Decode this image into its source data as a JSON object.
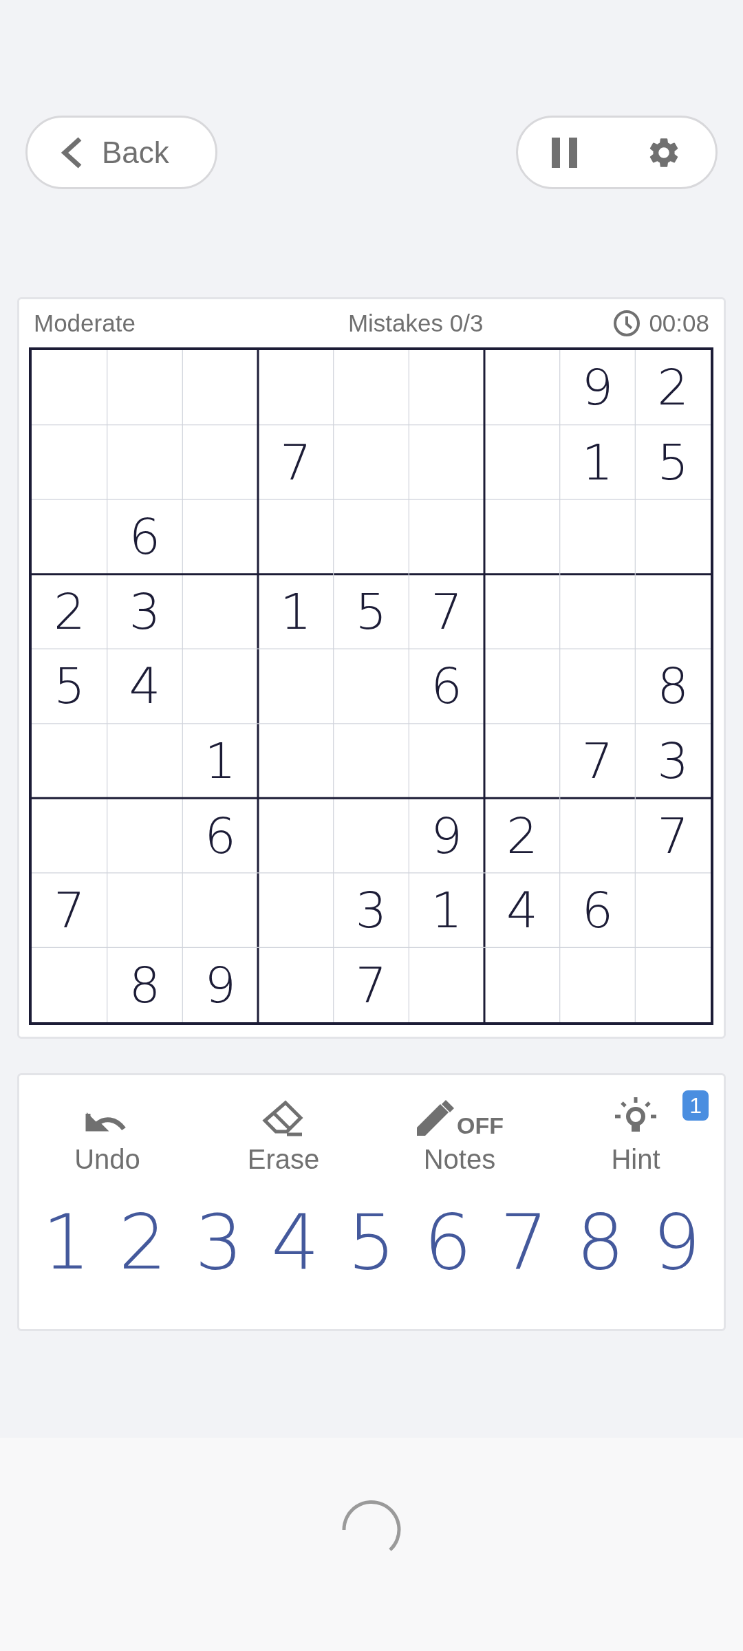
{
  "top_bar": {
    "back": {
      "label": "Back"
    }
  },
  "status": {
    "difficulty": "Moderate",
    "mistakes": "Mistakes 0/3",
    "timer": "00:08"
  },
  "grid": [
    [
      {
        "kind": "blank"
      },
      {
        "kind": "blank"
      },
      {
        "kind": "blank"
      },
      {
        "kind": "blank"
      },
      {
        "kind": "blank"
      },
      {
        "kind": "blank"
      },
      {
        "kind": "blank"
      },
      {
        "kind": "given",
        "digit": "9"
      },
      {
        "kind": "given",
        "digit": "2"
      }
    ],
    [
      {
        "kind": "blank"
      },
      {
        "kind": "blank"
      },
      {
        "kind": "blank"
      },
      {
        "kind": "given",
        "digit": "7"
      },
      {
        "kind": "blank"
      },
      {
        "kind": "blank"
      },
      {
        "kind": "blank"
      },
      {
        "kind": "given",
        "digit": "1"
      },
      {
        "kind": "given",
        "digit": "5"
      }
    ],
    [
      {
        "kind": "blank"
      },
      {
        "kind": "given",
        "digit": "6"
      },
      {
        "kind": "blank"
      },
      {
        "kind": "blank"
      },
      {
        "kind": "blank"
      },
      {
        "kind": "blank"
      },
      {
        "kind": "blank"
      },
      {
        "kind": "blank"
      },
      {
        "kind": "blank"
      }
    ],
    [
      {
        "kind": "given",
        "digit": "2"
      },
      {
        "kind": "given",
        "digit": "3"
      },
      {
        "kind": "blank"
      },
      {
        "kind": "given",
        "digit": "1"
      },
      {
        "kind": "given",
        "digit": "5"
      },
      {
        "kind": "given",
        "digit": "7"
      },
      {
        "kind": "blank"
      },
      {
        "kind": "blank"
      },
      {
        "kind": "blank"
      }
    ],
    [
      {
        "kind": "given",
        "digit": "5"
      },
      {
        "kind": "given",
        "digit": "4"
      },
      {
        "kind": "blank"
      },
      {
        "kind": "blank"
      },
      {
        "kind": "blank"
      },
      {
        "kind": "given",
        "digit": "6"
      },
      {
        "kind": "blank"
      },
      {
        "kind": "blank"
      },
      {
        "kind": "given",
        "digit": "8"
      }
    ],
    [
      {
        "kind": "blank"
      },
      {
        "kind": "blank"
      },
      {
        "kind": "given",
        "digit": "1"
      },
      {
        "kind": "blank"
      },
      {
        "kind": "blank"
      },
      {
        "kind": "blank"
      },
      {
        "kind": "blank"
      },
      {
        "kind": "given",
        "digit": "7"
      },
      {
        "kind": "given",
        "digit": "3"
      }
    ],
    [
      {
        "kind": "blank"
      },
      {
        "kind": "blank"
      },
      {
        "kind": "given",
        "digit": "6"
      },
      {
        "kind": "blank"
      },
      {
        "kind": "blank"
      },
      {
        "kind": "given",
        "digit": "9"
      },
      {
        "kind": "given",
        "digit": "2"
      },
      {
        "kind": "blank"
      },
      {
        "kind": "given",
        "digit": "7"
      }
    ],
    [
      {
        "kind": "given",
        "digit": "7"
      },
      {
        "kind": "blank"
      },
      {
        "kind": "blank"
      },
      {
        "kind": "blank"
      },
      {
        "kind": "given",
        "digit": "3"
      },
      {
        "kind": "given",
        "digit": "1"
      },
      {
        "kind": "given",
        "digit": "4"
      },
      {
        "kind": "given",
        "digit": "6"
      },
      {
        "kind": "blank"
      }
    ],
    [
      {
        "kind": "blank"
      },
      {
        "kind": "given",
        "digit": "8"
      },
      {
        "kind": "given",
        "digit": "9"
      },
      {
        "kind": "blank"
      },
      {
        "kind": "given",
        "digit": "7"
      },
      {
        "kind": "blank"
      },
      {
        "kind": "blank"
      },
      {
        "kind": "blank"
      },
      {
        "kind": "blank"
      }
    ]
  ],
  "tools": [
    {
      "kind": "undo",
      "label": "Undo"
    },
    {
      "kind": "erase",
      "label": "Erase"
    },
    {
      "kind": "notes",
      "label": "Notes",
      "on": false,
      "state_label": "OFF"
    },
    {
      "kind": "hint",
      "label": "Hint",
      "badge": "1"
    }
  ],
  "keypad": [
    "1",
    "2",
    "3",
    "4",
    "5",
    "6",
    "7",
    "8",
    "9"
  ],
  "loading": true
}
